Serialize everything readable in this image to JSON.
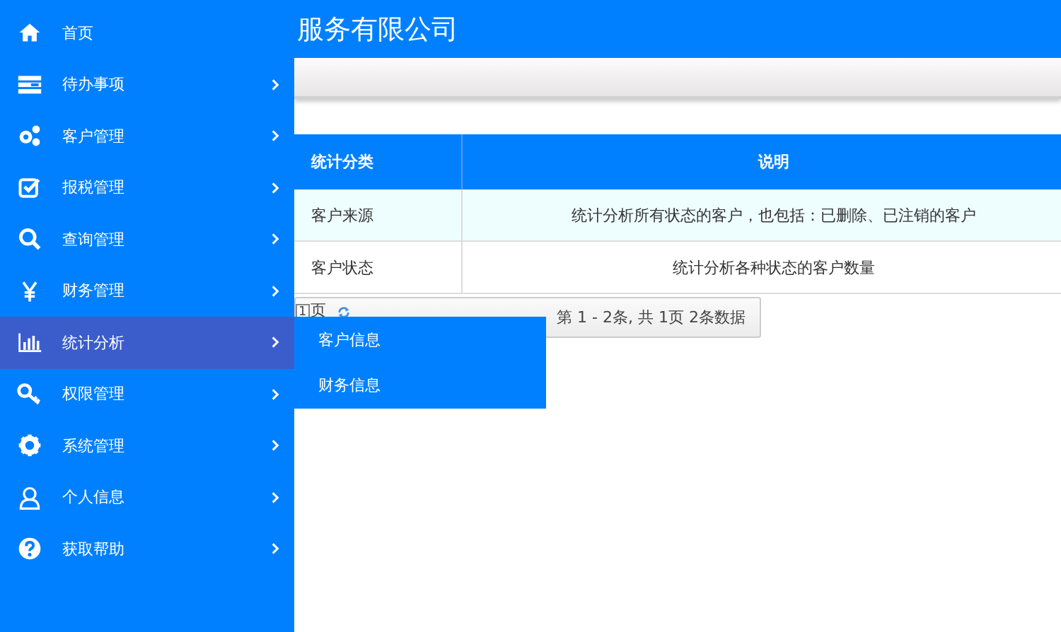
{
  "header": {
    "title": "服务有限公司"
  },
  "sidebar": {
    "items": [
      {
        "label": "首页",
        "has_submenu": false,
        "selected": false
      },
      {
        "label": "待办事项",
        "has_submenu": true,
        "selected": false
      },
      {
        "label": "客户管理",
        "has_submenu": true,
        "selected": false
      },
      {
        "label": "报税管理",
        "has_submenu": true,
        "selected": false
      },
      {
        "label": "查询管理",
        "has_submenu": true,
        "selected": false
      },
      {
        "label": "财务管理",
        "has_submenu": true,
        "selected": false
      },
      {
        "label": "统计分析",
        "has_submenu": true,
        "selected": true,
        "submenu": [
          "客户信息",
          "财务信息"
        ]
      },
      {
        "label": "权限管理",
        "has_submenu": true,
        "selected": false
      },
      {
        "label": "系统管理",
        "has_submenu": true,
        "selected": false
      },
      {
        "label": "个人信息",
        "has_submenu": true,
        "selected": false
      },
      {
        "label": "获取帮助",
        "has_submenu": true,
        "selected": false
      }
    ]
  },
  "table": {
    "columns": [
      "统计分类",
      "说明"
    ],
    "rows": [
      {
        "cells": [
          "客户来源",
          "统计分析所有状态的客户，也包括：已删除、已注销的客户"
        ],
        "highlighted": true
      },
      {
        "cells": [
          "客户状态",
          "统计分析各种状态的客户数量"
        ],
        "highlighted": false
      }
    ]
  },
  "pager": {
    "page": "1",
    "page_suffix": "页",
    "summary": "第 1 - 2条, 共 1页 2条数据"
  }
}
